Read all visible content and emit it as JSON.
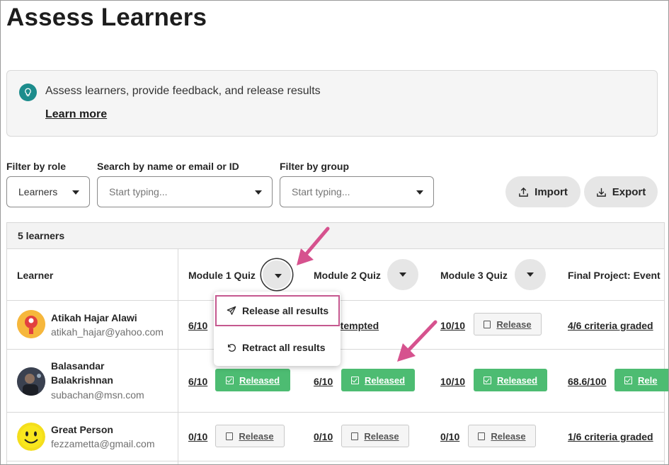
{
  "page": {
    "title": "Assess Learners"
  },
  "banner": {
    "message": "Assess learners, provide feedback, and release results",
    "link": "Learn more",
    "icon": "lightbulb-icon"
  },
  "filters": {
    "role": {
      "label": "Filter by role",
      "value": "Learners"
    },
    "search": {
      "label": "Search by name or email or ID",
      "placeholder": "Start typing..."
    },
    "group": {
      "label": "Filter by group",
      "placeholder": "Start typing..."
    }
  },
  "actions": {
    "import": "Import",
    "export": "Export"
  },
  "table": {
    "count": "5 learners",
    "columns": [
      "Learner",
      "Module 1 Quiz",
      "Module 2 Quiz",
      "Module 3 Quiz",
      "Final Project: Event"
    ],
    "rows": [
      {
        "name": "Atikah Hajar Alawi",
        "email": "atikah_hajar@yahoo.com",
        "m1": "6/10",
        "m2": "...tempted",
        "m3": "10/10",
        "m3_status": "Release",
        "final": "4/6 criteria graded"
      },
      {
        "name_line1": "Balasandar",
        "name_line2": "Balakrishnan",
        "email": "subachan@msn.com",
        "m1": "6/10",
        "m1_status": "Released",
        "m2": "6/10",
        "m2_status": "Released",
        "m3": "10/10",
        "m3_status": "Released",
        "final": "68.6/100",
        "final_status": "Rele"
      },
      {
        "name": "Great Person",
        "email": "fezzametta@gmail.com",
        "m1": "0/10",
        "m1_status": "Release",
        "m2": "0/10",
        "m2_status": "Release",
        "m3": "0/10",
        "m3_status": "Release",
        "final": "1/6 criteria graded"
      }
    ]
  },
  "menu": {
    "release_all": "Release all results",
    "retract_all": "Retract all results"
  },
  "colors": {
    "accent_teal": "#1c8c8c",
    "released_green": "#4dbc72",
    "annotation_pink": "#d6528e"
  }
}
